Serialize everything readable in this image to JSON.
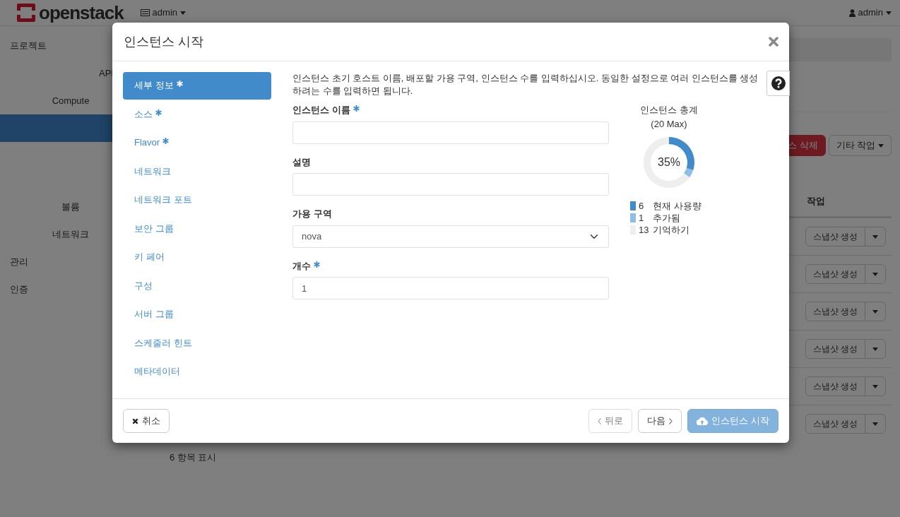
{
  "topbar": {
    "logo_text": "openstack",
    "project_menu": "admin",
    "user_menu": "admin"
  },
  "sidebar": {
    "items": [
      {
        "label": "프로젝트",
        "kind": "section",
        "selected": false
      },
      {
        "label": "API",
        "kind": "cut",
        "selected": false
      },
      {
        "label": "Compute",
        "kind": "group",
        "selected": false
      },
      {
        "kind": "group",
        "selected": true
      },
      {
        "label": "볼륨",
        "kind": "group",
        "selected": false
      },
      {
        "label": "네트워크",
        "kind": "group",
        "selected": false
      },
      {
        "label": "관리",
        "kind": "section",
        "selected": false
      },
      {
        "label": "인증",
        "kind": "section",
        "selected": false
      }
    ]
  },
  "main": {
    "actions": [
      {
        "label": "스 삭제",
        "kind": "danger"
      },
      {
        "label": "기타 작업",
        "kind": "dropdown"
      }
    ],
    "table": {
      "columns": [
        "작업"
      ],
      "rows": [
        {
          "action": "스냅샷 생성"
        },
        {
          "action": "스냅샷 생성"
        },
        {
          "action": "스냅샷 생성"
        },
        {
          "action": "스냅샷 생성"
        },
        {
          "action": "스냅샷 생성"
        },
        {
          "action": "스냅샷 생성"
        }
      ]
    },
    "footer": "6 항목 표시"
  },
  "modal": {
    "title": "인스턴스 시작",
    "steps": [
      {
        "label": "세부 정보",
        "required": true,
        "selected": true
      },
      {
        "label": "소스",
        "required": true,
        "selected": false
      },
      {
        "label": "Flavor",
        "required": true,
        "selected": false
      },
      {
        "label": "네트워크",
        "required": false,
        "selected": false
      },
      {
        "label": "네트워크 포트",
        "required": false,
        "selected": false
      },
      {
        "label": "보안 그룹",
        "required": false,
        "selected": false
      },
      {
        "label": "키 페어",
        "required": false,
        "selected": false
      },
      {
        "label": "구성",
        "required": false,
        "selected": false
      },
      {
        "label": "서버 그룹",
        "required": false,
        "selected": false
      },
      {
        "label": "스케줄러 힌트",
        "required": false,
        "selected": false
      },
      {
        "label": "메타데이터",
        "required": false,
        "selected": false
      }
    ],
    "help_text": "인스턴스 초기 호스트 이름, 배포할 가용 구역, 인스턴스 수를 입력하십시오. 동일한 설정으로 여러 인스턴스를 생성하려는 수를 입력하면 됩니다.",
    "fields": [
      {
        "label": "인스턴스 이름",
        "kind": "text",
        "required": true
      },
      {
        "label": "설명",
        "kind": "text",
        "required": false
      },
      {
        "label": "가용 구역",
        "kind": "select",
        "required": false,
        "value": "nova"
      },
      {
        "label": "개수",
        "kind": "text",
        "required": true,
        "value": "1"
      }
    ],
    "quota": {
      "max_label": "(20 Max)",
      "center_label": "35%",
      "chart_data": {
        "type": "donut",
        "title": "인스턴스 총계",
        "values": [
          30,
          5,
          65
        ]
      },
      "legend": [
        {
          "count": "6",
          "label": "현재 사용량",
          "color": "#428bca"
        },
        {
          "count": "1",
          "label": "추가됨",
          "color": "#8fbde6"
        },
        {
          "count": "13",
          "label": "기억하기",
          "color": "#eeeeee"
        }
      ]
    },
    "buttons": {
      "cancel": {
        "label": "취소"
      },
      "back": {
        "label": "뒤로",
        "disabled": true
      },
      "next": {
        "label": "다음"
      },
      "launch": {
        "label": "인스턴스 시작",
        "disabled": true
      }
    }
  }
}
